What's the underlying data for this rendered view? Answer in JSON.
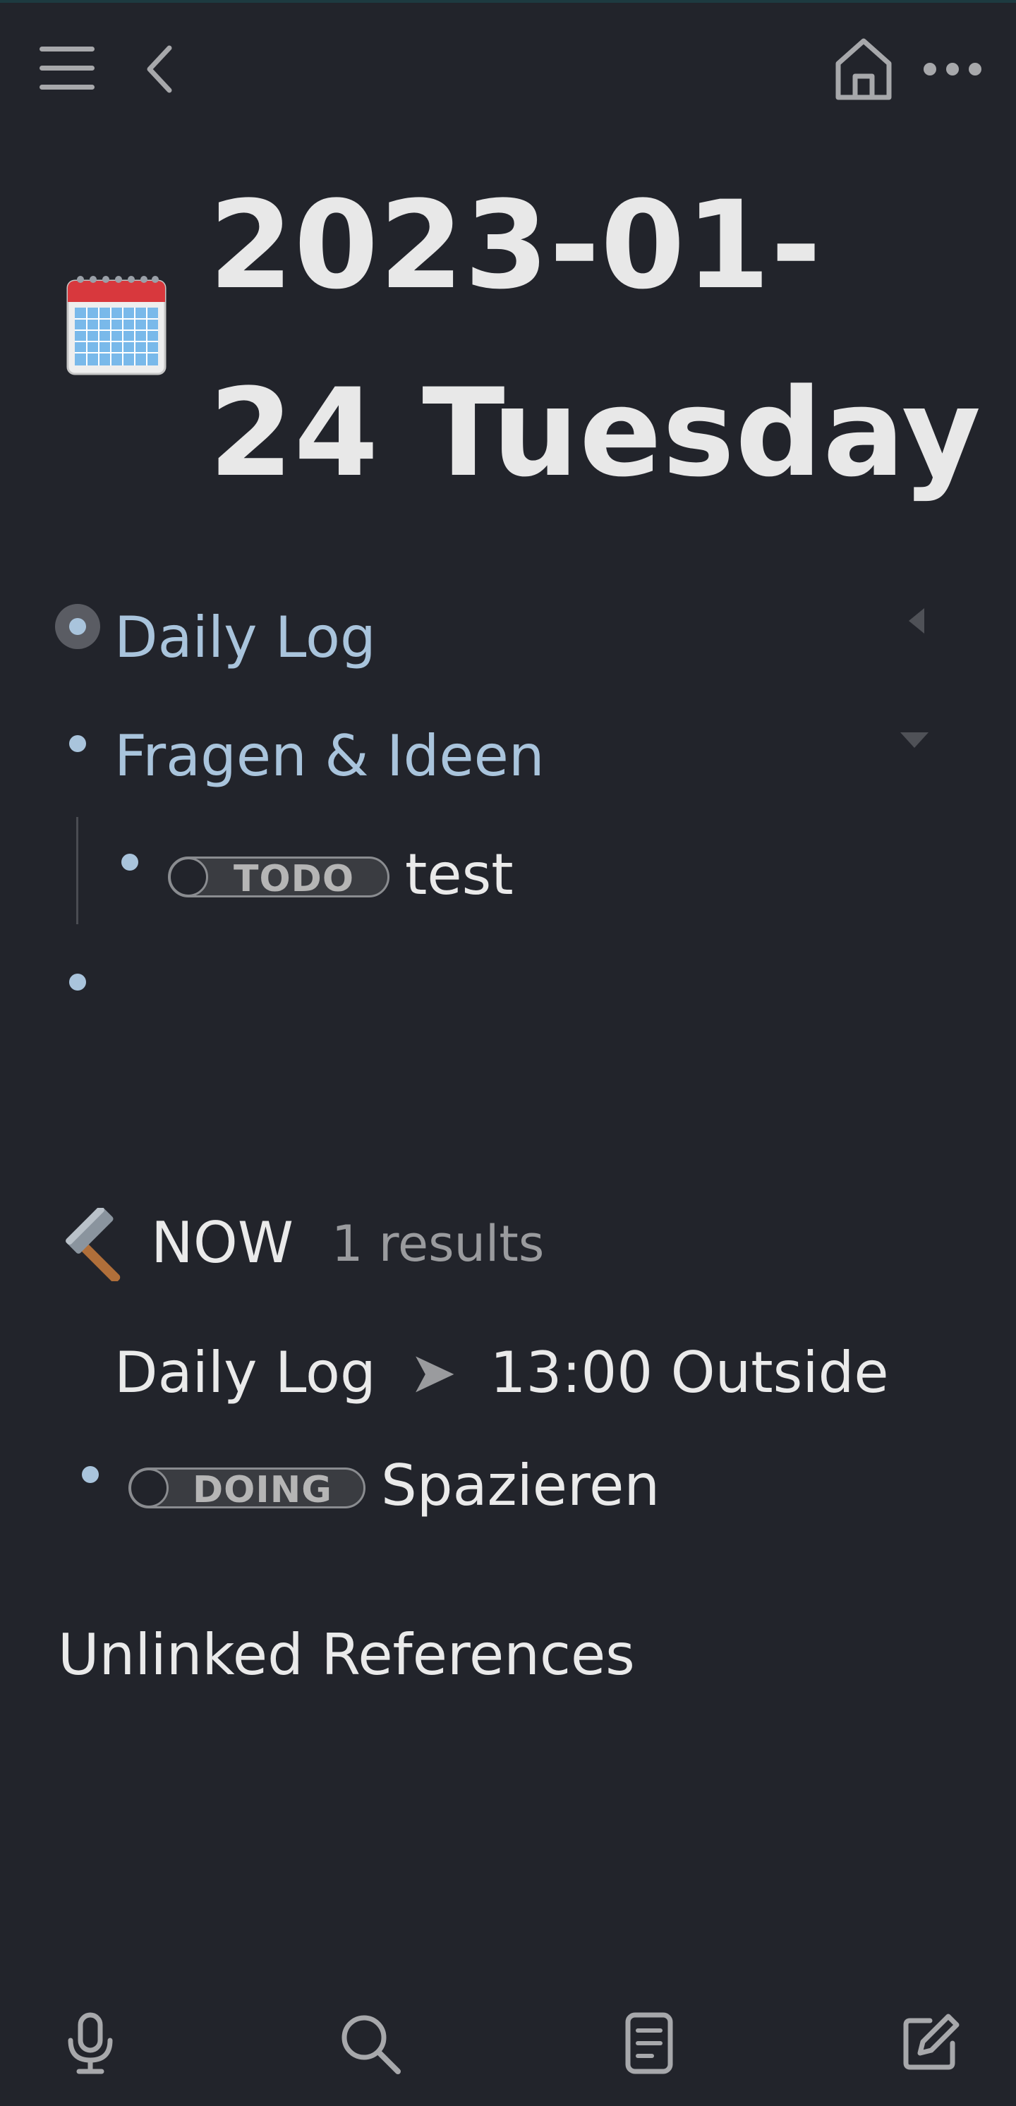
{
  "header": {
    "menu_icon": "hamburger-menu-icon",
    "back_icon": "chevron-left-icon",
    "home_icon": "home-icon",
    "more_icon": "more-horizontal-icon"
  },
  "page": {
    "icon": "calendar-emoji",
    "title_line1": "2023-01-",
    "title_line2": "24 Tuesday"
  },
  "blocks": [
    {
      "label": "Daily Log",
      "collapse_icon": "caret-left-icon"
    },
    {
      "label": "Fragen & Ideen",
      "collapse_icon": "caret-down-icon",
      "children": [
        {
          "marker": "TODO",
          "text": "test"
        }
      ]
    },
    {
      "label": ""
    }
  ],
  "now_query": {
    "icon": "hammer-emoji",
    "title": "NOW",
    "count": "1 results",
    "group": {
      "breadcrumb_parent": "Daily Log",
      "separator": "➤",
      "breadcrumb_child": "13:00 Outside"
    },
    "item": {
      "marker": "DOING",
      "text": "Spazieren"
    }
  },
  "unlinked": {
    "title": "Unlinked References"
  },
  "bottom_nav": {
    "icons": [
      "microphone-icon",
      "search-icon",
      "document-icon",
      "edit-icon"
    ]
  },
  "colors": {
    "background": "#22242b",
    "link": "#a9c4dc",
    "text": "#e6e6e6",
    "muted": "#9a9b9e"
  }
}
